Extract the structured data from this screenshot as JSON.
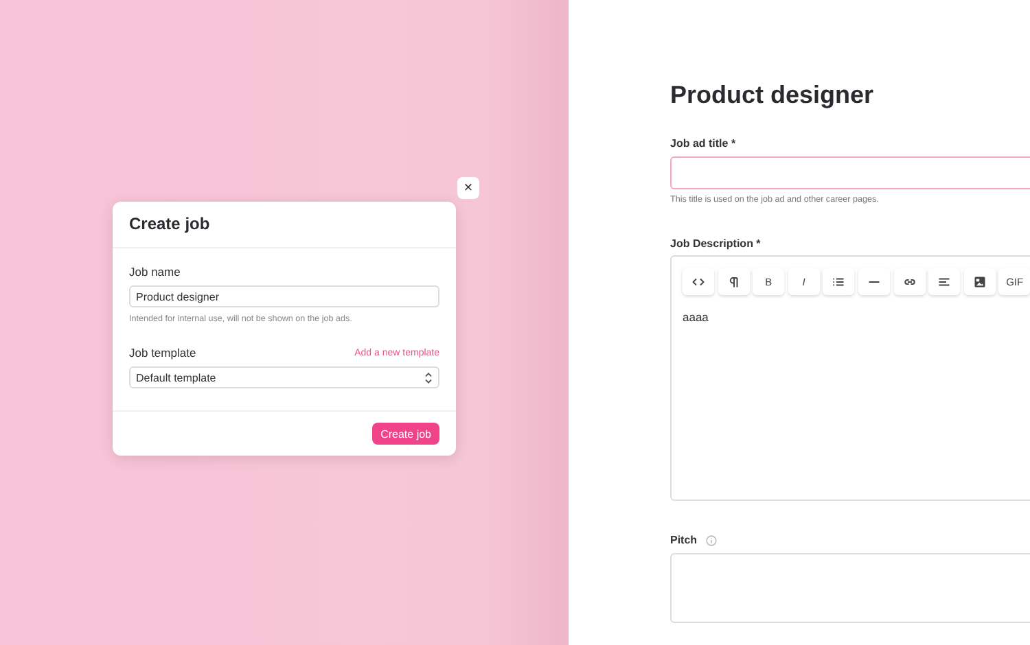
{
  "dialog": {
    "title": "Create job",
    "close_icon": "×",
    "job_name": {
      "label": "Job name",
      "value": "Product designer",
      "hint": "Intended for internal use, will not be shown on the job ads."
    },
    "job_template": {
      "label": "Job template",
      "link": "Add a new template",
      "value": "Default template"
    },
    "submit": "Create job"
  },
  "page": {
    "title": "Product designer",
    "job_ad_title": {
      "label": "Job ad title *",
      "hint": "This title is used on the job ad and other career pages."
    },
    "job_description": {
      "label": "Job Description *",
      "toolbar": [
        {
          "kind": "code"
        },
        {
          "kind": "paragraph"
        },
        {
          "kind": "text",
          "label": "B"
        },
        {
          "kind": "text",
          "label": "I"
        },
        {
          "kind": "list"
        },
        {
          "kind": "rule"
        },
        {
          "kind": "link"
        },
        {
          "kind": "align"
        },
        {
          "kind": "image"
        },
        {
          "kind": "text",
          "label": "GIF"
        }
      ],
      "value": "aaaa"
    },
    "pitch": {
      "label": "Pitch"
    }
  }
}
